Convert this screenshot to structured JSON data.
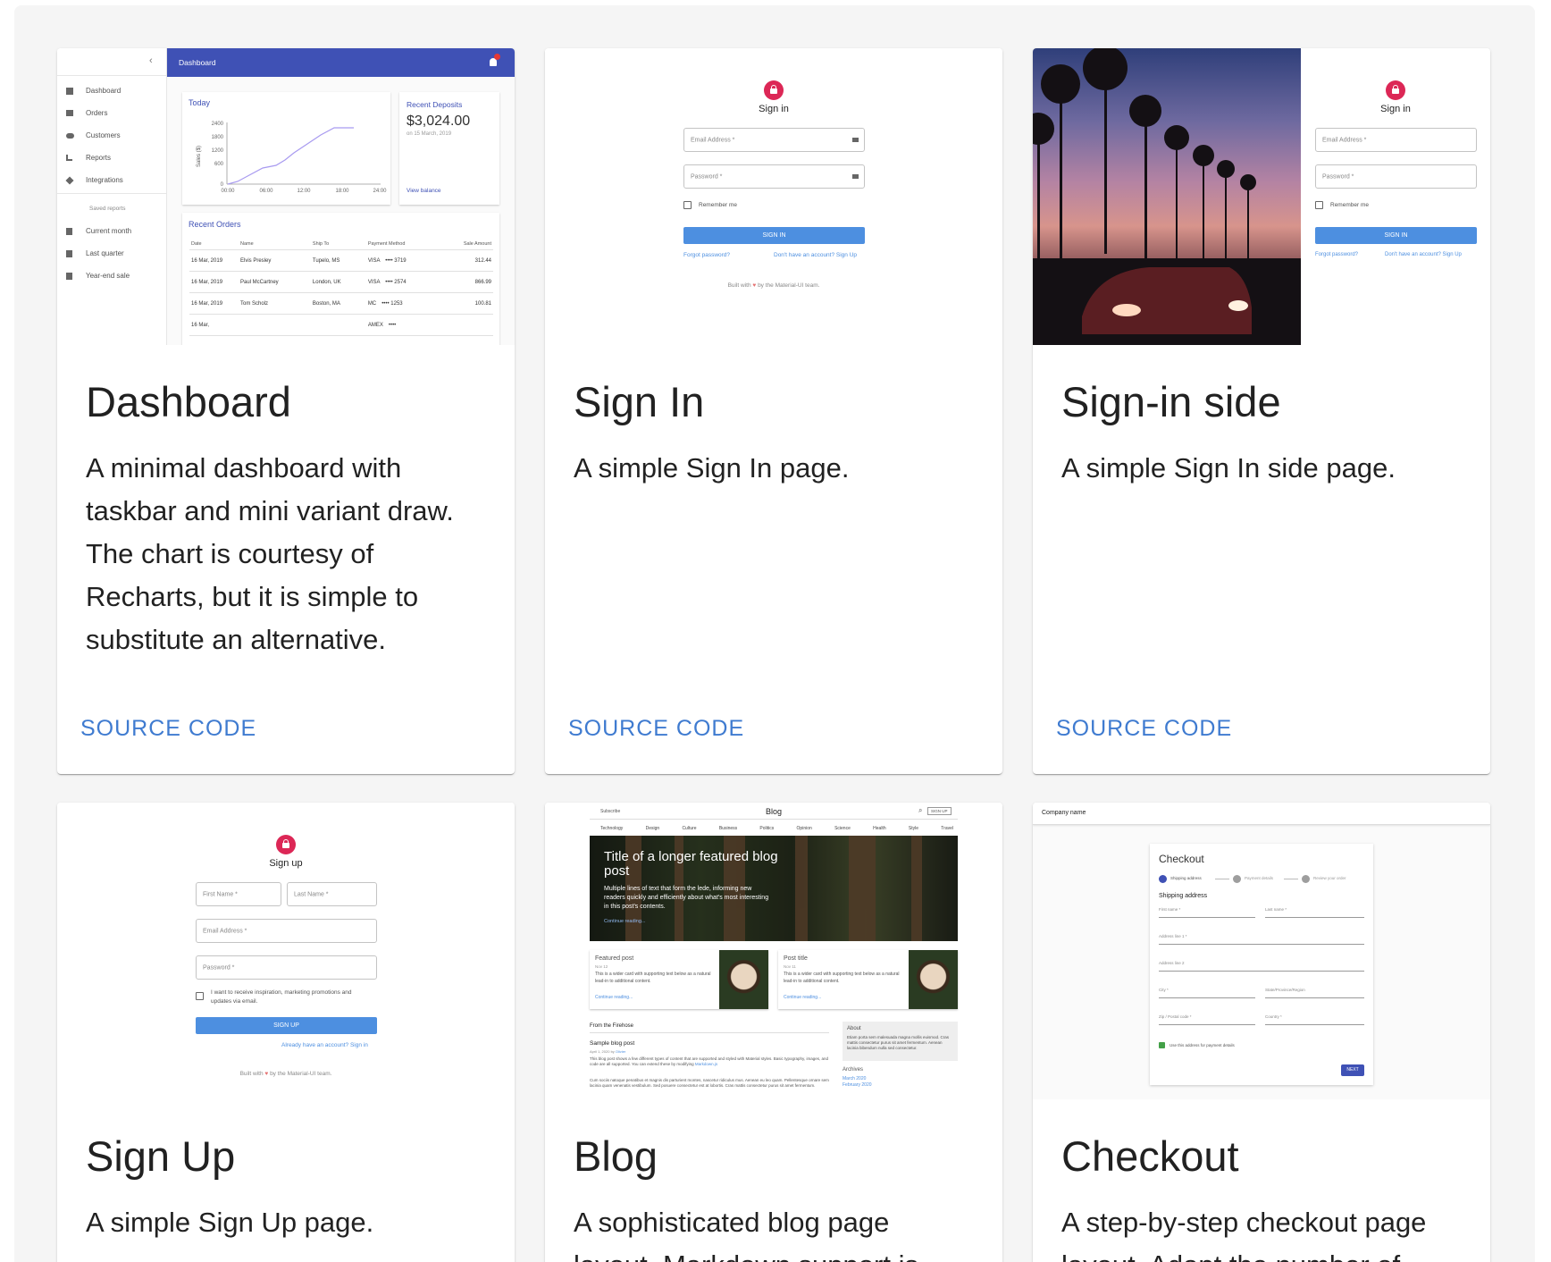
{
  "cards": [
    {
      "title": "Dashboard",
      "description": "A minimal dashboard with taskbar and mini variant draw. The chart is courtesy of Recharts, but it is simple to substitute an alternative.",
      "action": "SOURCE CODE",
      "preview": {
        "appbar_title": "Dashboard",
        "nav": [
          "Dashboard",
          "Orders",
          "Customers",
          "Reports",
          "Integrations"
        ],
        "saved_header": "Saved reports",
        "saved": [
          "Current month",
          "Last quarter",
          "Year-end sale"
        ],
        "chart_title": "Today",
        "chart_ylabel": "Sales ($)",
        "chart_yticks": [
          "2400",
          "1800",
          "1200",
          "600",
          "0"
        ],
        "chart_xticks": [
          "00:00",
          "06:00",
          "12:00",
          "18:00",
          "24:00"
        ],
        "deposits_title": "Recent Deposits",
        "deposits_amount": "$3,024.00",
        "deposits_date": "on 15 March, 2019",
        "deposits_link": "View balance",
        "orders_title": "Recent Orders",
        "orders_headers": [
          "Date",
          "Name",
          "Ship To",
          "Payment Method",
          "Sale Amount"
        ],
        "orders_rows": [
          [
            "16 Mar, 2019",
            "Elvis Presley",
            "Tupelo, MS",
            "VISA ⠀•••• 3719",
            "312.44"
          ],
          [
            "16 Mar, 2019",
            "Paul McCartney",
            "London, UK",
            "VISA ⠀•••• 2574",
            "866.99"
          ],
          [
            "16 Mar, 2019",
            "Tom Scholz",
            "Boston, MA",
            "MC ⠀•••• 1253",
            "100.81"
          ],
          [
            "16 Mar,",
            "",
            "",
            "AMEX ⠀••••",
            ""
          ]
        ]
      }
    },
    {
      "title": "Sign In",
      "description": "A simple Sign In page.",
      "action": "SOURCE CODE",
      "preview": {
        "heading": "Sign in",
        "email": "Email Address *",
        "password": "Password *",
        "remember": "Remember me",
        "button": "SIGN IN",
        "forgot": "Forgot password?",
        "signup": "Don't have an account? Sign Up",
        "footer_before": "Built with",
        "footer_after": "by the Material-UI team."
      }
    },
    {
      "title": "Sign-in side",
      "description": "A simple Sign In side page.",
      "action": "SOURCE CODE",
      "preview": {
        "heading": "Sign in",
        "email": "Email Address *",
        "password": "Password *",
        "remember": "Remember me",
        "button": "SIGN IN",
        "forgot": "Forgot password?",
        "signup": "Don't have an account? Sign Up"
      }
    },
    {
      "title": "Sign Up",
      "description": "A simple Sign Up page.",
      "preview": {
        "heading": "Sign up",
        "first": "First Name *",
        "last": "Last Name *",
        "email": "Email Address *",
        "password": "Password *",
        "consent": "I want to receive inspiration, marketing promotions and updates via email.",
        "button": "SIGN UP",
        "signin": "Already have an account? Sign in",
        "footer_before": "Built with",
        "footer_after": "by the Material-UI team."
      }
    },
    {
      "title": "Blog",
      "description": "A sophisticated blog page layout. Markdown support is",
      "preview": {
        "subscribe": "Subscribe",
        "site_title": "Blog",
        "signup": "SIGN UP",
        "sections": [
          "Technology",
          "Design",
          "Culture",
          "Business",
          "Politics",
          "Opinion",
          "Science",
          "Health",
          "Style",
          "Travel"
        ],
        "hero_title": "Title of a longer featured blog post",
        "hero_text": "Multiple lines of text that form the lede, informing new readers quickly and efficiently about what's most interesting in this post's contents.",
        "hero_link": "Continue reading...",
        "posts": [
          {
            "title": "Featured post",
            "date": "Nov 12",
            "text": "This is a wider card with supporting text below as a natural lead-in to additional content.",
            "link": "Continue reading..."
          },
          {
            "title": "Post title",
            "date": "Nov 11",
            "text": "This is a wider card with supporting text below as a natural lead-in to additional content.",
            "link": "Continue reading..."
          }
        ],
        "firehose": "From the Firehose",
        "sample_title": "Sample blog post",
        "sample_date": "April 1, 2020 by",
        "sample_author": "Olivier",
        "sample_text1": "This blog post shows a few different types of content that are supported and styled with Material styles. Basic typography, images, and code are all supported. You can extend these by modifying",
        "sample_markup": "Markdown.js",
        "sample_text2": "Cum sociis natoque penatibus et magnis dis parturient montes, nascetur ridiculus mus. Aenean eu leo quam. Pellentesque ornare sem lacinia quam venenatis vestibulum. Sed posuere consectetur est at lobortis. Cras mattis consectetur purus sit amet fermentum.",
        "about_title": "About",
        "about_text": "Etiam porta sem malesuada magna mollis euismod. Cras mattis consectetur purus sit amet fermentum. Aenean lacinia bibendum nulla sed consectetur.",
        "archives_title": "Archives",
        "archives": [
          "March 2020",
          "February 2020"
        ]
      }
    },
    {
      "title": "Checkout",
      "description": "A step-by-step checkout page layout. Adapt the number of",
      "preview": {
        "company": "Company name",
        "heading": "Checkout",
        "steps": [
          "Shipping address",
          "Payment details",
          "Review your order"
        ],
        "section": "Shipping address",
        "first": "First name *",
        "last": "Last name *",
        "address1": "Address line 1 *",
        "address2": "Address line 2",
        "city": "City *",
        "state": "State/Province/Region",
        "zip": "Zip / Postal code *",
        "country": "Country *",
        "use_address": "Use this address for payment details",
        "next": "NEXT"
      }
    }
  ],
  "colors": {
    "page": "#f5f5f5",
    "action": "#3f7bd0",
    "appbar": "#3f51b5",
    "lock": "#dc2756",
    "primary_button": "#4d8fe0"
  },
  "icons": [
    "chevron-left-icon",
    "bell-icon",
    "dashboard-icon",
    "cart-icon",
    "people-icon",
    "bar-chart-icon",
    "layers-icon",
    "assignment-icon",
    "lock-icon",
    "heart-icon",
    "search-icon",
    "key-icon"
  ]
}
